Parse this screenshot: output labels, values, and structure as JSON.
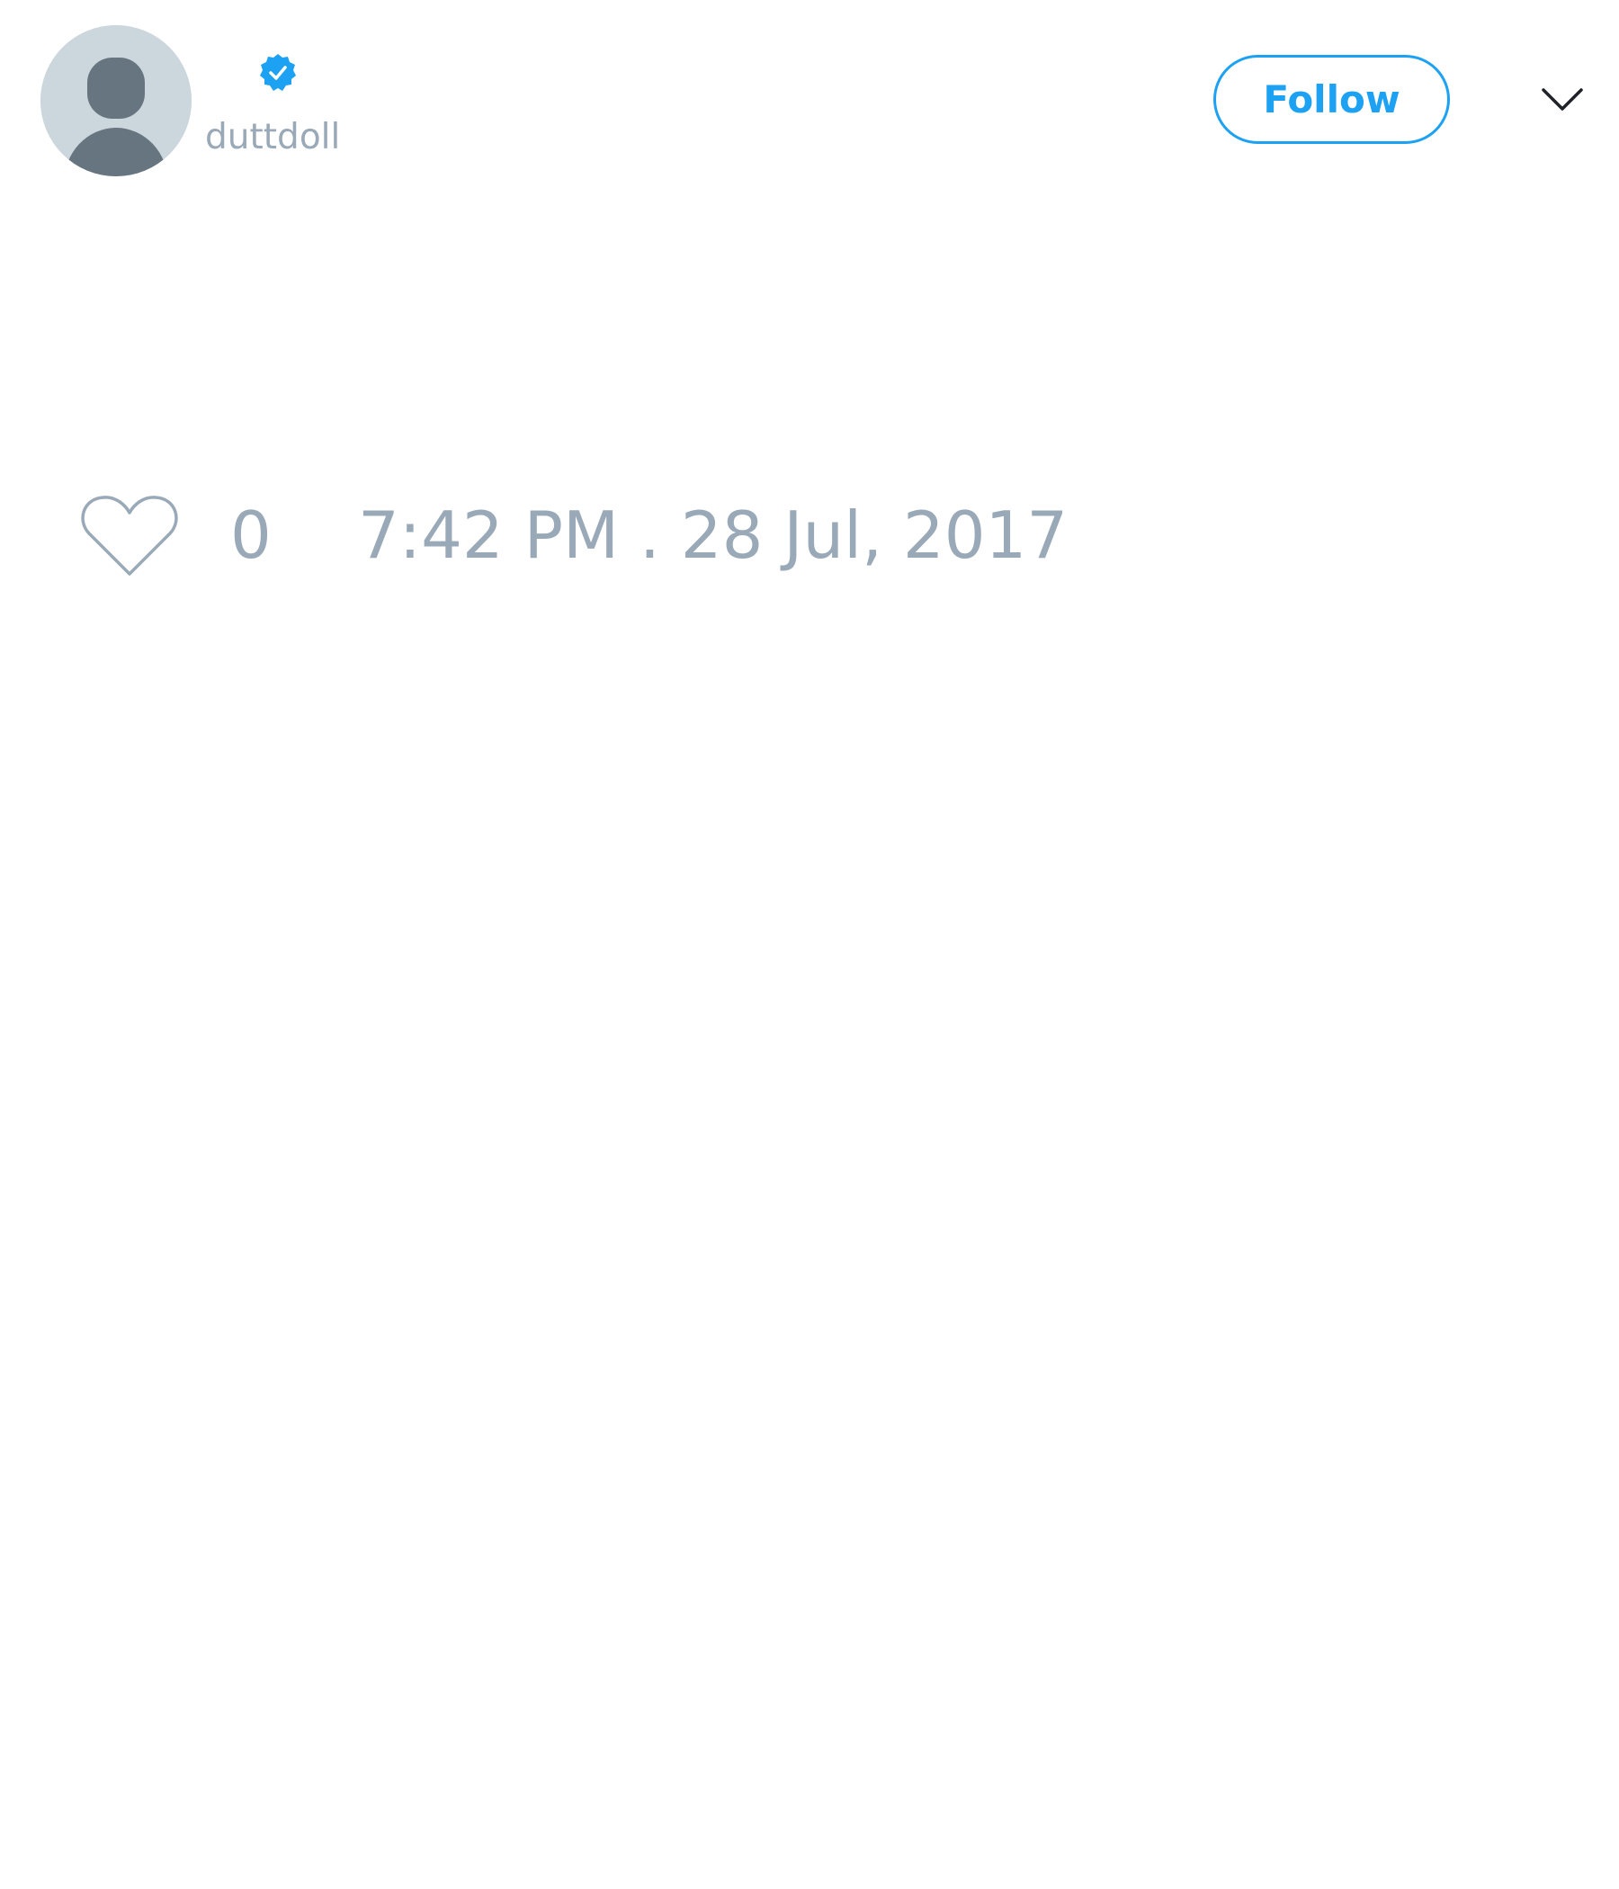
{
  "author": {
    "handle": "duttdoll",
    "verified": true,
    "avatar_icon": "default-profile-silhouette-icon"
  },
  "header": {
    "follow_label": "Follow",
    "menu_icon": "chevron-down-icon"
  },
  "footer": {
    "like_icon": "heart-outline-icon",
    "like_count": "0",
    "timestamp": "7:42 PM . 28 Jul, 2017"
  },
  "colors": {
    "accent": "#1da1f2",
    "muted_text": "#9aa9b8",
    "avatar_bg": "#ccd6dd",
    "avatar_fg": "#66757f",
    "background": "#ffffff"
  }
}
